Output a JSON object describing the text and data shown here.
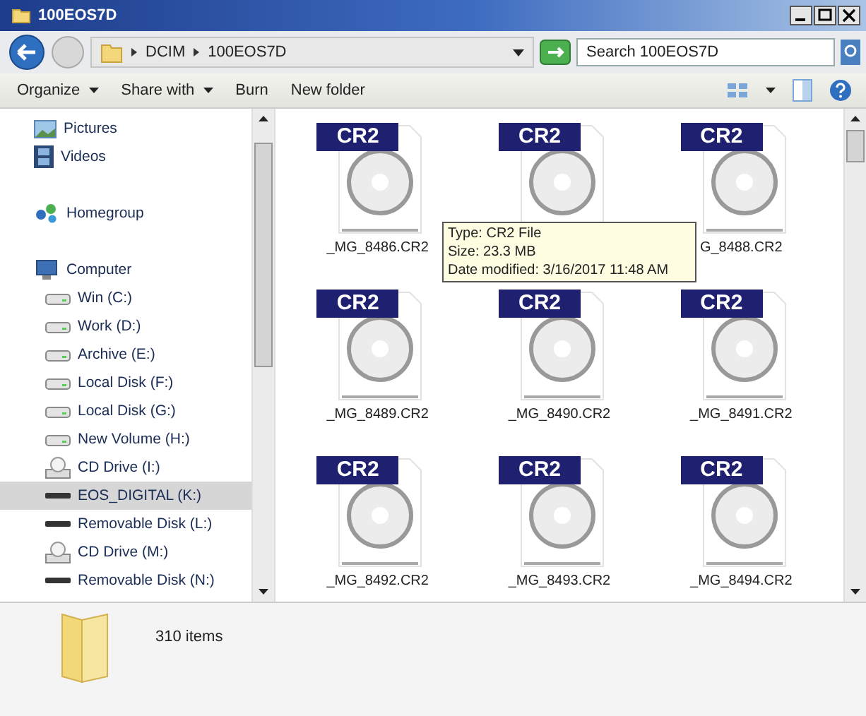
{
  "window": {
    "title": "100EOS7D"
  },
  "address": {
    "crumbs": [
      "DCIM",
      "100EOS7D"
    ]
  },
  "search": {
    "placeholder": "Search 100EOS7D"
  },
  "toolbar": [
    {
      "label": "Organize",
      "dropdown": true
    },
    {
      "label": "Share with",
      "dropdown": true
    },
    {
      "label": "Burn",
      "dropdown": false
    },
    {
      "label": "New folder",
      "dropdown": false
    }
  ],
  "sidebar": {
    "items": [
      {
        "label": "Pictures",
        "kind": "pictures",
        "selected": false
      },
      {
        "label": "Videos",
        "kind": "videos",
        "selected": false,
        "gap_after": true
      },
      {
        "label": "Homegroup",
        "kind": "homegroup",
        "selected": false,
        "gap_after": true
      },
      {
        "label": "Computer",
        "kind": "computer",
        "selected": false
      },
      {
        "label": "Win (C:)",
        "kind": "drive",
        "selected": false
      },
      {
        "label": "Work (D:)",
        "kind": "drive",
        "selected": false
      },
      {
        "label": "Archive (E:)",
        "kind": "drive",
        "selected": false
      },
      {
        "label": "Local Disk (F:)",
        "kind": "drive",
        "selected": false
      },
      {
        "label": "Local Disk (G:)",
        "kind": "drive",
        "selected": false
      },
      {
        "label": "New Volume (H:)",
        "kind": "drive",
        "selected": false
      },
      {
        "label": "CD Drive (I:)",
        "kind": "cd",
        "selected": false
      },
      {
        "label": "EOS_DIGITAL (K:)",
        "kind": "removable",
        "selected": true
      },
      {
        "label": "Removable Disk (L:)",
        "kind": "removable",
        "selected": false
      },
      {
        "label": "CD Drive (M:)",
        "kind": "cd",
        "selected": false
      },
      {
        "label": "Removable Disk (N:)",
        "kind": "removable",
        "selected": false
      }
    ]
  },
  "files": [
    {
      "badge": "CR2",
      "name": "_MG_8486.CR2"
    },
    {
      "badge": "CR2"
    },
    {
      "badge": "CR2",
      "name": "G_8488.CR2"
    },
    {
      "badge": "CR2",
      "name": "_MG_8489.CR2"
    },
    {
      "badge": "CR2",
      "name": "_MG_8490.CR2"
    },
    {
      "badge": "CR2",
      "name": "_MG_8491.CR2"
    },
    {
      "badge": "CR2",
      "name": "_MG_8492.CR2"
    },
    {
      "badge": "CR2",
      "name": "_MG_8493.CR2"
    },
    {
      "badge": "CR2",
      "name": "_MG_8494.CR2"
    }
  ],
  "tooltip": {
    "lines": [
      "Type: CR2 File",
      "Size: 23.3 MB",
      "Date modified: 3/16/2017 11:48 AM"
    ]
  },
  "status_bar": {
    "text": "310 items"
  }
}
